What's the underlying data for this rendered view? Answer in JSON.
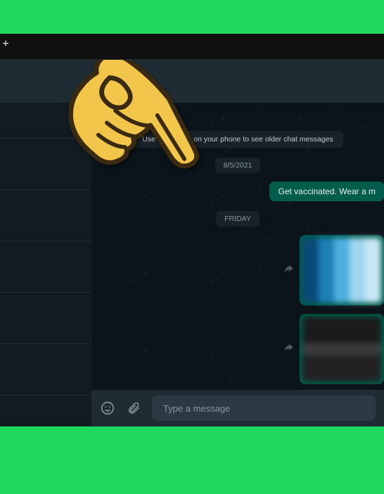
{
  "toolbar": {
    "plus": "+"
  },
  "chat": {
    "notice": "Use WhatsApp on your phone to see older chat messages",
    "dates": {
      "d1": "8/5/2021",
      "d2": "FRIDAY"
    },
    "msg1": "Get vaccinated. Wear a m"
  },
  "composer": {
    "placeholder": "Type a message"
  }
}
